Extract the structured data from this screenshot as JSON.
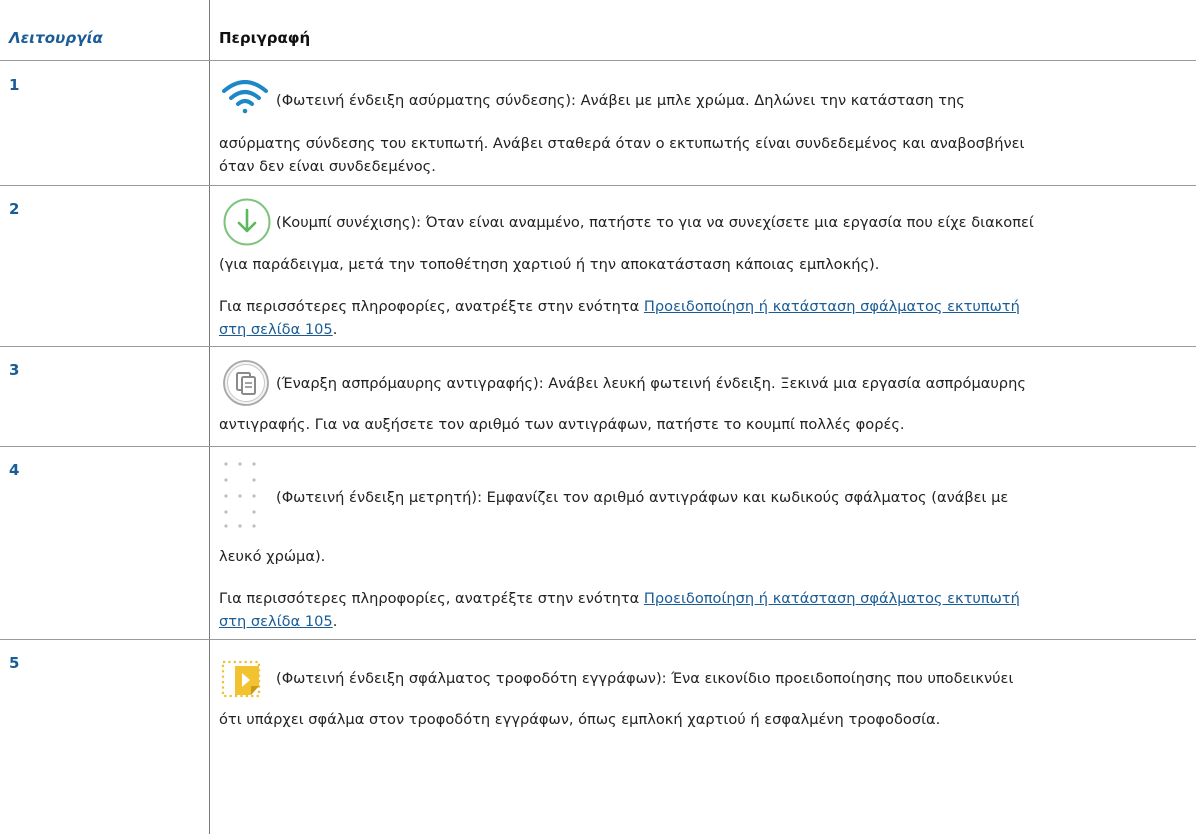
{
  "table": {
    "header": {
      "function": "Λειτουργία",
      "description": "Περιγραφή"
    },
    "rows": [
      {
        "number": "1",
        "icon": "wifi-icon",
        "lines": [
          "(Φωτεινή ένδειξη ασύρματης σύνδεσης): Ανάβει με μπλε χρώμα. Δηλώνει την κατάσταση της",
          "ασύρματης σύνδεσης του εκτυπωτή. Ανάβει σταθερά όταν ο εκτυπωτής είναι συνδεδεμένος και αναβοσβήνει",
          "όταν δεν είναι συνδεδεμένος."
        ]
      },
      {
        "number": "2",
        "icon": "resume-button-icon",
        "lines": [
          "(Κουμπί συνέχισης): Όταν είναι αναμμένο, πατήστε το για να συνεχίσετε μια εργασία που είχε διακοπεί",
          "(για παράδειγμα, μετά την τοποθέτηση χαρτιού ή την αποκατάσταση κάποιας εμπλοκής)."
        ],
        "more_info": {
          "prefix": "Για περισσότερες πληροφορίες, ανατρέξτε στην ενότητα ",
          "link_line1": "Προειδοποίηση ή κατάσταση σφάλματος εκτυπωτή",
          "link_line2": "στη σελίδα 105",
          "suffix": "."
        }
      },
      {
        "number": "3",
        "icon": "copy-button-icon",
        "lines": [
          "(Έναρξη ασπρόμαυρης αντιγραφής): Ανάβει λευκή φωτεινή ένδειξη. Ξεκινά μια εργασία ασπρόμαυρης",
          "αντιγραφής. Για να αυξήσετε τον αριθμό των αντιγράφων, πατήστε το κουμπί πολλές φορές."
        ]
      },
      {
        "number": "4",
        "icon": "counter-display-icon",
        "lines": [
          "(Φωτεινή ένδειξη μετρητή): Εμφανίζει τον αριθμό αντιγράφων και κωδικούς σφάλματος (ανάβει με",
          "λευκό χρώμα)."
        ],
        "more_info": {
          "prefix": "Για περισσότερες πληροφορίες, ανατρέξτε στην ενότητα ",
          "link_line1": "Προειδοποίηση ή κατάσταση σφάλματος εκτυπωτή",
          "link_line2": "στη σελίδα 105",
          "suffix": "."
        }
      },
      {
        "number": "5",
        "icon": "document-feeder-error-icon",
        "lines": [
          "(Φωτεινή ένδειξη σφάλματος τροφοδότη εγγράφων): Ένα εικονίδιο προειδοποίησης που υποδεικνύει",
          "ότι υπάρχει σφάλμα στον τροφοδότη εγγράφων, όπως εμπλοκή χαρτιού ή εσφαλμένη τροφοδοσία."
        ]
      }
    ]
  },
  "colors": {
    "accent": "#1a5c96",
    "wifi": "#1e88c7",
    "resume": "#5cb85c",
    "copy": "#8a8a8a",
    "feeder": "#e8c233"
  }
}
